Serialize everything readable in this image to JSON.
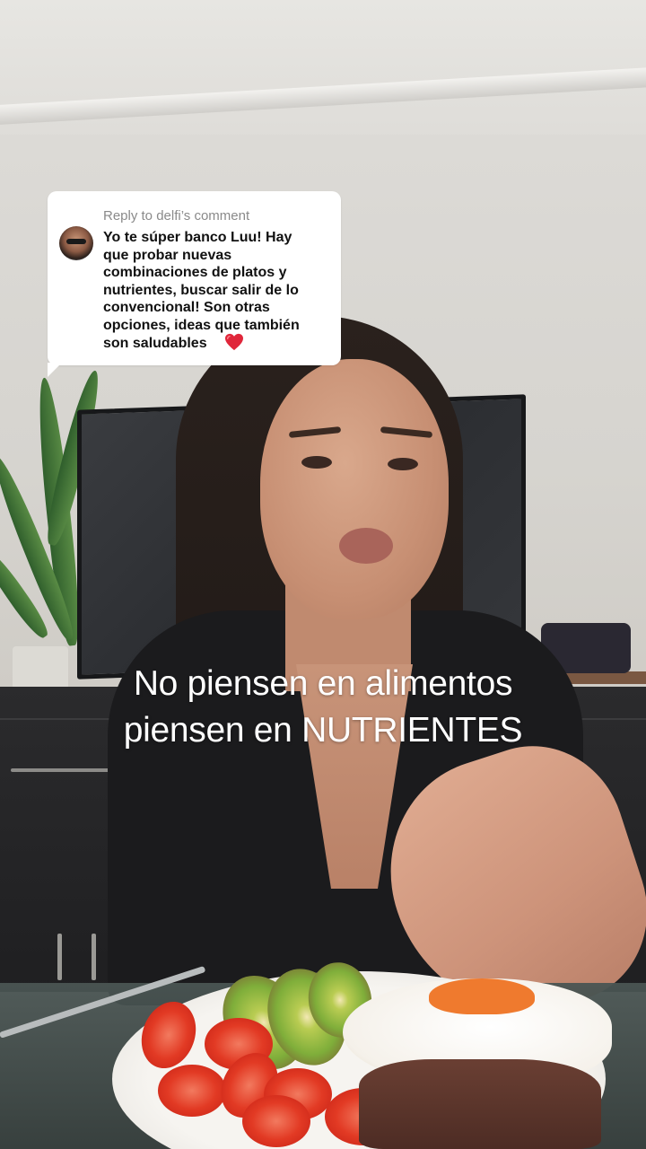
{
  "comment_reply": {
    "reply_label": "Reply to delfi’s comment",
    "comment_text": "Yo te súper banco Luu! Hay\nque probar nuevas\ncombinaciones de platos y\nnutrientes, buscar salir de lo\nconvencional! Son otras\nopciones, ideas que también\nson saludables",
    "emoji_icon": "red-heart-icon",
    "colors": {
      "bubble": "#ffffff",
      "label": "#8a8a8a",
      "text": "#111111",
      "heart": "#e0263a"
    }
  },
  "captions": {
    "line1": "No piensen en alimentos",
    "line2": "piensen en NUTRIENTES"
  }
}
